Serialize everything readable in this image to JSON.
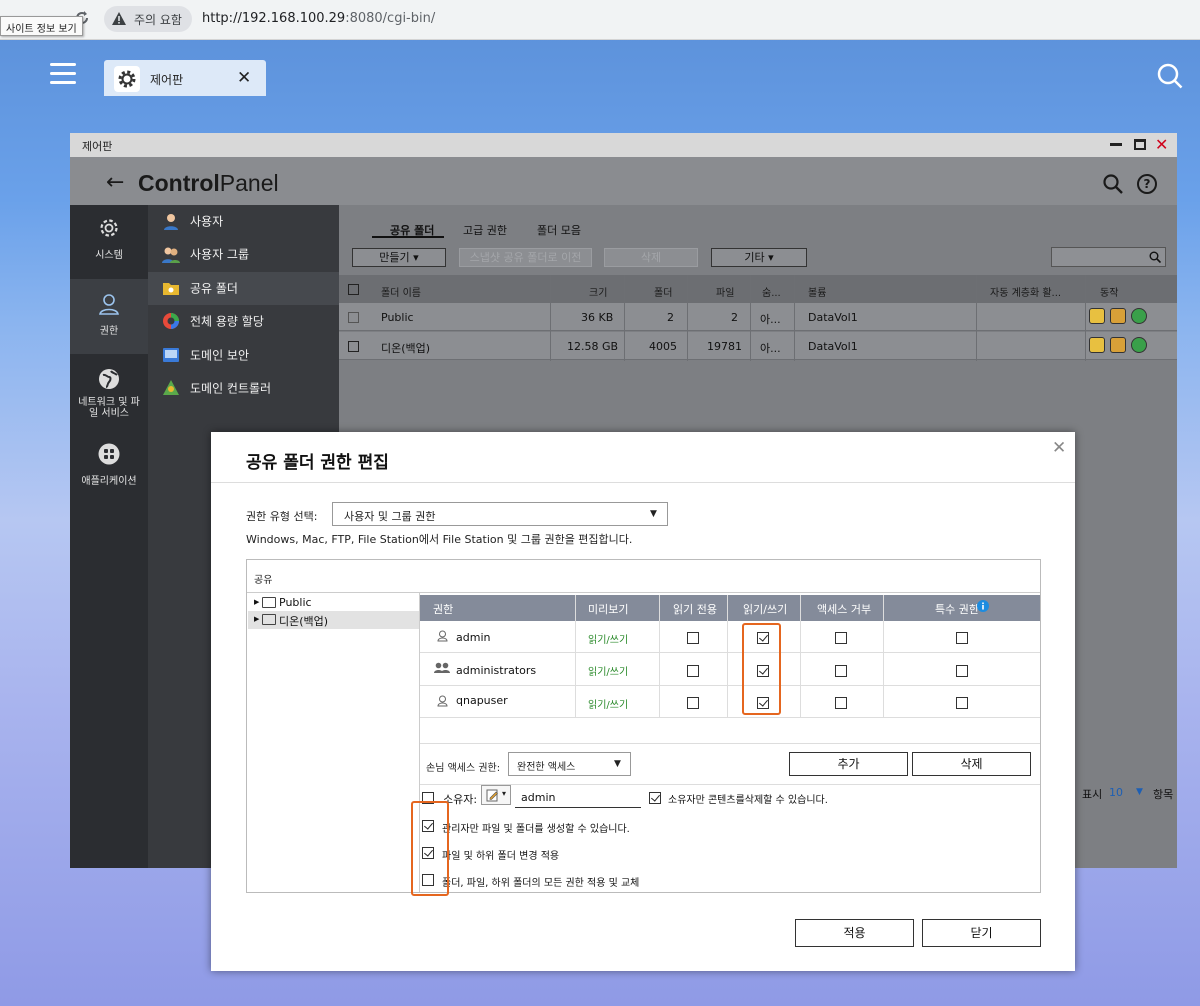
{
  "browser": {
    "warning": "주의 요함",
    "url_host": "http://192.168.100.29",
    "url_rest": ":8080/cgi-bin/",
    "site_info_tooltip": "사이트 정보 보기"
  },
  "desktop": {
    "tab_label": "제어판",
    "tab_close": "✕"
  },
  "window": {
    "title": "제어판",
    "header_title_bold": "Control",
    "header_title_rest": "Panel",
    "help": "?"
  },
  "left_nav": {
    "items": [
      {
        "label": "시스템",
        "icon": "gear-icon"
      },
      {
        "label": "권한",
        "icon": "user-icon",
        "active": true
      },
      {
        "label": "네트워크 및 파일 서비스",
        "icon": "globe-icon"
      },
      {
        "label": "애플리케이션",
        "icon": "apps-icon"
      }
    ]
  },
  "sub_nav": {
    "items": [
      {
        "label": "사용자",
        "icon": "user-icon"
      },
      {
        "label": "사용자 그룹",
        "icon": "user-group-icon"
      },
      {
        "label": "공유 폴더",
        "icon": "shared-folder-icon",
        "active": true
      },
      {
        "label": "전체 용량 할당",
        "icon": "quota-icon"
      },
      {
        "label": "도메인 보안",
        "icon": "domain-security-icon"
      },
      {
        "label": "도메인 컨트롤러",
        "icon": "domain-controller-icon"
      }
    ]
  },
  "content": {
    "tabs": [
      "공유 폴더",
      "고급 권한",
      "폴더 모음"
    ],
    "toolbar": {
      "create": "만들기",
      "snapshot": "스냅샷 공유 폴더로 이전",
      "delete": "삭제",
      "more": "기타"
    },
    "columns": [
      "폴더 이름",
      "크기",
      "폴더",
      "파일",
      "숨...",
      "볼륨",
      "자동 계층화 활...",
      "동작"
    ],
    "rows": [
      {
        "name": "Public",
        "size": "36 KB",
        "folders": "2",
        "files": "2",
        "hidden": "아...",
        "volume": "DataVol1"
      },
      {
        "name": "디온(백업)",
        "size": "12.58 GB",
        "folders": "4005",
        "files": "19781",
        "hidden": "아...",
        "volume": "DataVol1"
      }
    ],
    "pager": {
      "show": "표시",
      "count": "10",
      "items": "항목"
    }
  },
  "dialog": {
    "title": "공유 폴더 권한 편집",
    "permission_type_label": "권한 유형 선택:",
    "permission_type_value": "사용자 및 그룹 권한",
    "description": "Windows, Mac, FTP, File Station에서 File Station 및 그룹 권한을 편집합니다.",
    "share_label": "공유",
    "tree": [
      "Public",
      "디온(백업)"
    ],
    "perm_columns": [
      "권한",
      "미리보기",
      "읽기 전용",
      "읽기/쓰기",
      "액세스 거부",
      "특수 권한"
    ],
    "perm_rows": [
      {
        "name": "admin",
        "preview": "읽기/쓰기",
        "read_only": false,
        "read_write": true,
        "deny": false,
        "special": false
      },
      {
        "name": "administrators",
        "preview": "읽기/쓰기",
        "read_only": false,
        "read_write": true,
        "deny": false,
        "special": false
      },
      {
        "name": "qnapuser",
        "preview": "읽기/쓰기",
        "read_only": false,
        "read_write": true,
        "deny": false,
        "special": false
      }
    ],
    "guest_label": "손님 액세스 권한:",
    "guest_value": "완전한 액세스",
    "add": "추가",
    "remove": "삭제",
    "owner_label": "소유자:",
    "owner_value": "admin",
    "owner_delete_only": "소유자만 콘텐츠를삭제할 수 있습니다.",
    "options": [
      {
        "label": "관리자만 파일 및 폴더를 생성할 수 있습니다.",
        "checked": true
      },
      {
        "label": "파일 및 하위 폴더 변경 적용",
        "checked": true
      },
      {
        "label": "폴더, 파일, 하위 폴더의 모든 권한 적용 및 교체",
        "checked": false
      }
    ],
    "apply": "적용",
    "close": "닫기"
  },
  "colors": {
    "highlight": "#e5661f",
    "preview_green": "#2a8a2a",
    "info_blue": "#1d8ce0"
  }
}
